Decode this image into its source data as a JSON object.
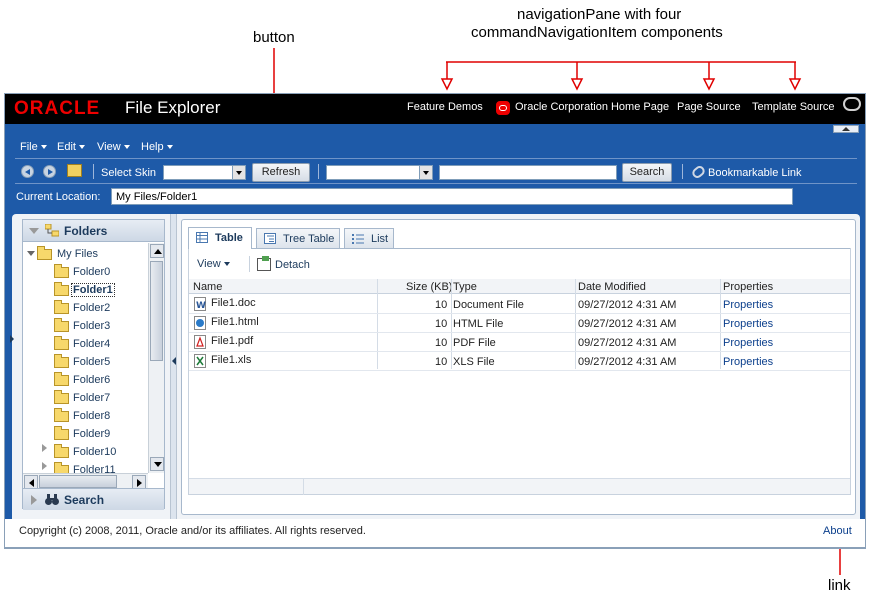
{
  "annotations": {
    "nav_pane_line1": "navigationPane with four",
    "nav_pane_line2": "commandNavigationItem components",
    "button": "button",
    "link": "link"
  },
  "header": {
    "brand": "ORACLE",
    "title": "File Explorer",
    "nav_items": [
      "Feature Demos",
      "Oracle Corporation Home Page",
      "Page Source",
      "Template Source"
    ]
  },
  "menubar": {
    "items": [
      "File",
      "Edit",
      "View",
      "Help"
    ]
  },
  "toolbar": {
    "select_skin_label": "Select Skin",
    "skin_value": "",
    "refresh_label": "Refresh",
    "search_scope_value": "",
    "search_value": "",
    "search_label": "Search",
    "bookmark_label": "Bookmarkable Link"
  },
  "location": {
    "label": "Current Location:",
    "value": "My Files/Folder1"
  },
  "navigator": {
    "folders_title": "Folders",
    "search_title": "Search",
    "tree": {
      "root": "My Files",
      "folders": [
        "Folder0",
        "Folder1",
        "Folder2",
        "Folder3",
        "Folder4",
        "Folder5",
        "Folder6",
        "Folder7",
        "Folder8",
        "Folder9",
        "Folder10",
        "Folder11"
      ],
      "selected": "Folder1"
    }
  },
  "content": {
    "tabs": [
      "Table",
      "Tree Table",
      "List"
    ],
    "active_tab": "Table",
    "view_label": "View",
    "detach_label": "Detach",
    "columns": [
      "Name",
      "Size (KB)",
      "Type",
      "Date Modified",
      "Properties"
    ],
    "rows": [
      {
        "name": "File1.doc",
        "size": "10",
        "type": "Document File",
        "modified": "09/27/2012 4:31 AM",
        "properties": "Properties",
        "icon": "word-doc-icon"
      },
      {
        "name": "File1.html",
        "size": "10",
        "type": "HTML File",
        "modified": "09/27/2012 4:31 AM",
        "properties": "Properties",
        "icon": "html-file-icon"
      },
      {
        "name": "File1.pdf",
        "size": "10",
        "type": "PDF File",
        "modified": "09/27/2012 4:31 AM",
        "properties": "Properties",
        "icon": "pdf-file-icon"
      },
      {
        "name": "File1.xls",
        "size": "10",
        "type": "XLS File",
        "modified": "09/27/2012 4:31 AM",
        "properties": "Properties",
        "icon": "excel-file-icon"
      }
    ]
  },
  "footer": {
    "copyright": "Copyright (c) 2008, 2011, Oracle and/or its affiliates. All rights reserved.",
    "about": "About"
  },
  "colors": {
    "app_blue": "#1e5aa8",
    "header_black": "#000000",
    "oracle_red": "#e00000",
    "annotation_red": "#e00000"
  }
}
